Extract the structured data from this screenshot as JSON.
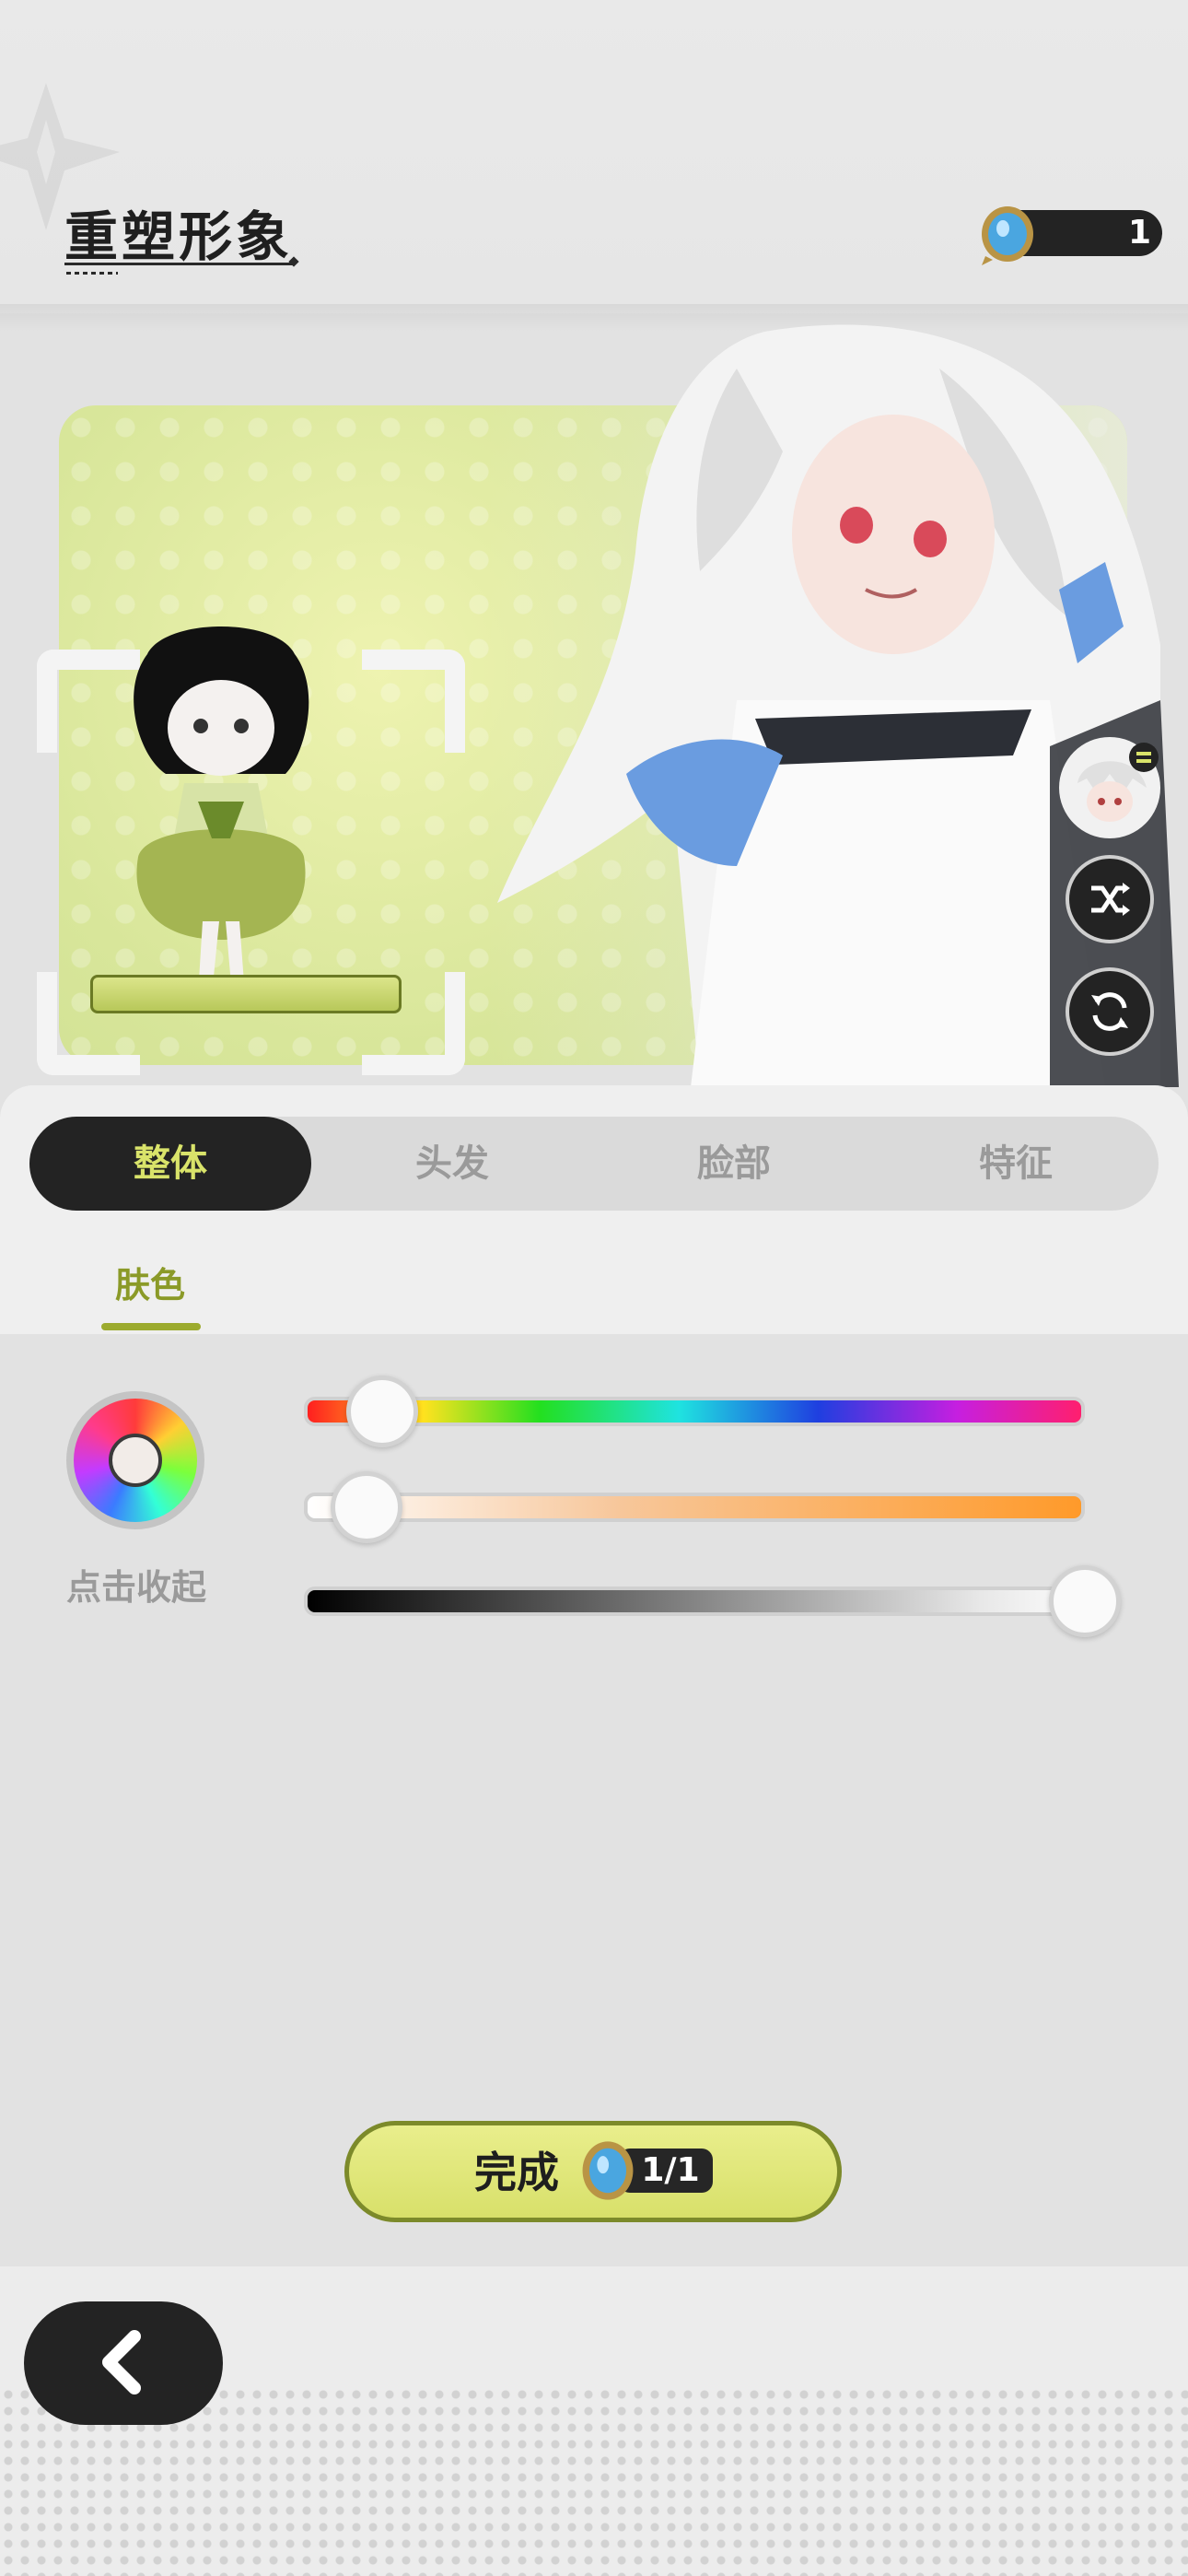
{
  "header": {
    "title": "重塑形象",
    "currency_icon": "mirror-token-icon",
    "currency_count": "1"
  },
  "preview": {
    "avatar_toggle_icon": "avatar-swap-icon",
    "random_icon": "shuffle-icon",
    "reset_icon": "refresh-icon"
  },
  "tabs": [
    {
      "label": "整体",
      "active": true
    },
    {
      "label": "头发",
      "active": false
    },
    {
      "label": "脸部",
      "active": false
    },
    {
      "label": "特征",
      "active": false
    }
  ],
  "subtab": {
    "label": "肤色"
  },
  "color_picker": {
    "collapse_label": "点击收起",
    "hue": 0.08,
    "saturation": 0.06,
    "brightness": 1.0
  },
  "confirm": {
    "label": "完成",
    "cost": "1/1",
    "cost_icon": "mirror-token-icon"
  },
  "footer": {
    "back_icon": "chevron-left-icon"
  },
  "colors": {
    "accent": "#d9e36a",
    "dark": "#232323",
    "subtab": "#8b9a28"
  }
}
